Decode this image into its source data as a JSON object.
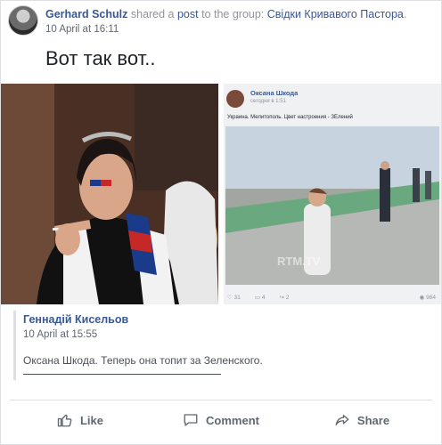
{
  "post": {
    "author": "Gerhard Schulz",
    "shared_text": " shared a ",
    "post_word": "post",
    "to_text": " to the group: ",
    "group": "Свідки Кривавого Пастора",
    "period": ".",
    "time": "10 April at 16:11",
    "text": "Вот так вот.."
  },
  "media": {
    "right_card": {
      "name": "Оксана Шкода",
      "subtime": "сегодня в 1:51",
      "caption": "Украина. Мелитополь. Цвет настроения - ЗЕлений",
      "watermark": "RTM.TV",
      "likes": "31",
      "comments": "4",
      "shares": "2",
      "views": "984"
    }
  },
  "comment": {
    "author": "Геннадій Кисельов",
    "time": "10 April at 15:55",
    "text": "Оксана Шкода. Теперь она топит за Зеленского."
  },
  "actions": {
    "like": "Like",
    "comment": "Comment",
    "share": "Share"
  },
  "colors": {
    "link": "#385898",
    "muted": "#90949c",
    "border": "#dddfe2",
    "action_text": "#606770"
  }
}
